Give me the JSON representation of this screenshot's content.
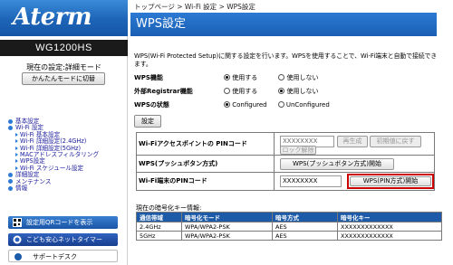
{
  "sidebar": {
    "logo": "Aterm",
    "model": "WG1200HS",
    "mode_label": "現在の設定:詳細モード",
    "easy_mode_button": "かんたんモードに切替",
    "nav": [
      {
        "label": "基本設定",
        "level": 0
      },
      {
        "label": "Wi-Fi 設定",
        "level": 0
      },
      {
        "label": "Wi-Fi 基本設定",
        "level": 1
      },
      {
        "label": "Wi-Fi 詳細設定(2.4GHz)",
        "level": 1
      },
      {
        "label": "Wi-Fi 詳細設定(5GHz)",
        "level": 1
      },
      {
        "label": "MACアドレスフィルタリング",
        "level": 1
      },
      {
        "label": "WPS設定",
        "level": 1
      },
      {
        "label": "Wi-Fi スケジュール設定",
        "level": 1
      },
      {
        "label": "詳細設定",
        "level": 0
      },
      {
        "label": "メンテナンス",
        "level": 0
      },
      {
        "label": "情報",
        "level": 0
      }
    ],
    "qr_button": "設定用QRコードを表示",
    "kids_button": "こども安心ネットタイマー",
    "support_button": "サポートデスク"
  },
  "main": {
    "breadcrumb": "トップページ > Wi-Fi 設定 > WPS設定",
    "title": "WPS設定",
    "description": "WPS(Wi-Fi Protected Setup)に関する設定を行います。WPSを使用することで、Wi-Fi端末と自動で接続できます。",
    "settings": {
      "wps": {
        "label": "WPS機能",
        "options": [
          "使用する",
          "使用しない"
        ],
        "selected": 0
      },
      "registrar": {
        "label": "外部Registrar機能",
        "options": [
          "使用する",
          "使用しない"
        ],
        "selected": 1
      },
      "state": {
        "label": "WPSの状態",
        "options": [
          "Configured",
          "UnConfigured"
        ],
        "selected": 0
      }
    },
    "settings_button": "設定",
    "wps_table": {
      "ap_pin_label": "Wi-Fiアクセスポイントの PINコード",
      "ap_pin_value": "XXXXXXXX",
      "regen_button": "再生成",
      "reset_button": "初期値に戻す",
      "unlock_button": "ロック解除",
      "push_label": "WPS(プッシュボタン方式)",
      "push_button": "WPS(プッシュボタン方式)開始",
      "client_pin_label": "Wi-Fi端末のPINコード",
      "client_pin_value": "XXXXXXXX",
      "pin_button": "WPS(PIN方式)開始"
    },
    "encryption": {
      "title": "現在の暗号化キー情報:",
      "headers": [
        "通信帯域",
        "暗号化モード",
        "暗号方式",
        "暗号化キー"
      ],
      "rows": [
        [
          "2.4GHz",
          "WPA/WPA2-PSK",
          "AES",
          "XXXXXXXXXXXXX"
        ],
        [
          "5GHz",
          "WPA/WPA2-PSK",
          "AES",
          "XXXXXXXXXXXXX"
        ]
      ]
    }
  },
  "colors": {
    "accent_blue": "#1d5ba8",
    "highlight_red": "#cc0000"
  }
}
